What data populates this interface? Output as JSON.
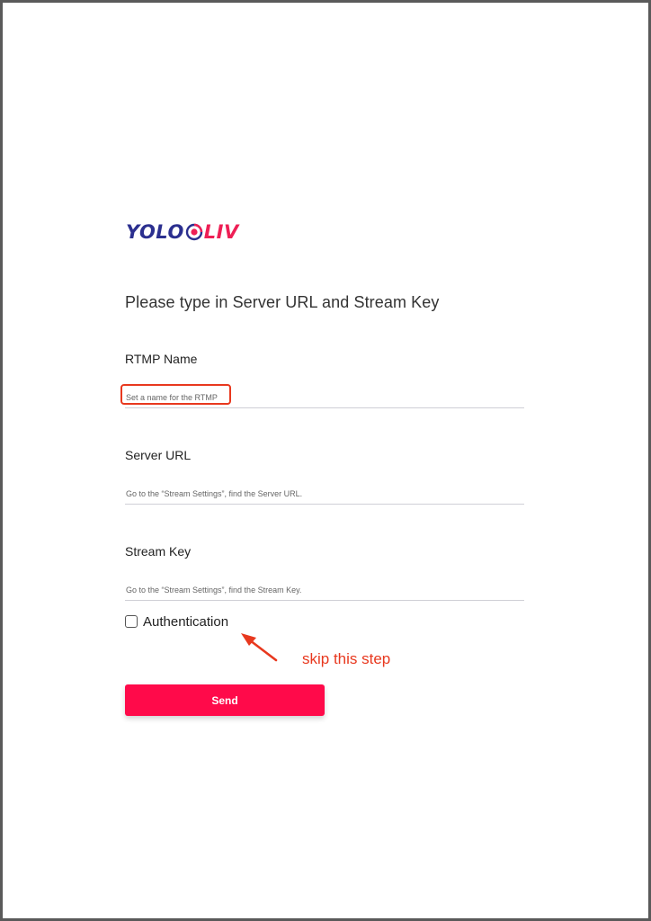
{
  "logo": {
    "left_text": "YOLO",
    "right_text": "LIV",
    "icon": "target-logo-icon",
    "colors": {
      "left": "#2b2f8f",
      "right": "#ee1f55"
    }
  },
  "form": {
    "title": "Please type in Server URL and Stream Key",
    "rtmp_name": {
      "label": "RTMP Name",
      "placeholder": "Set a name for the RTMP",
      "value": ""
    },
    "server_url": {
      "label": "Server URL",
      "placeholder": "Go to the “Stream Settings”, find the Server URL.",
      "value": ""
    },
    "stream_key": {
      "label": "Stream Key",
      "placeholder": "Go to the “Stream Settings”, find the Stream Key.",
      "value": ""
    },
    "authentication": {
      "label": "Authentication",
      "checked": false
    },
    "send_label": "Send"
  },
  "annotation": {
    "text": "skip this step",
    "color": "#e8381e",
    "icon": "arrow-icon"
  },
  "colors": {
    "accent": "#ff0a4a"
  }
}
